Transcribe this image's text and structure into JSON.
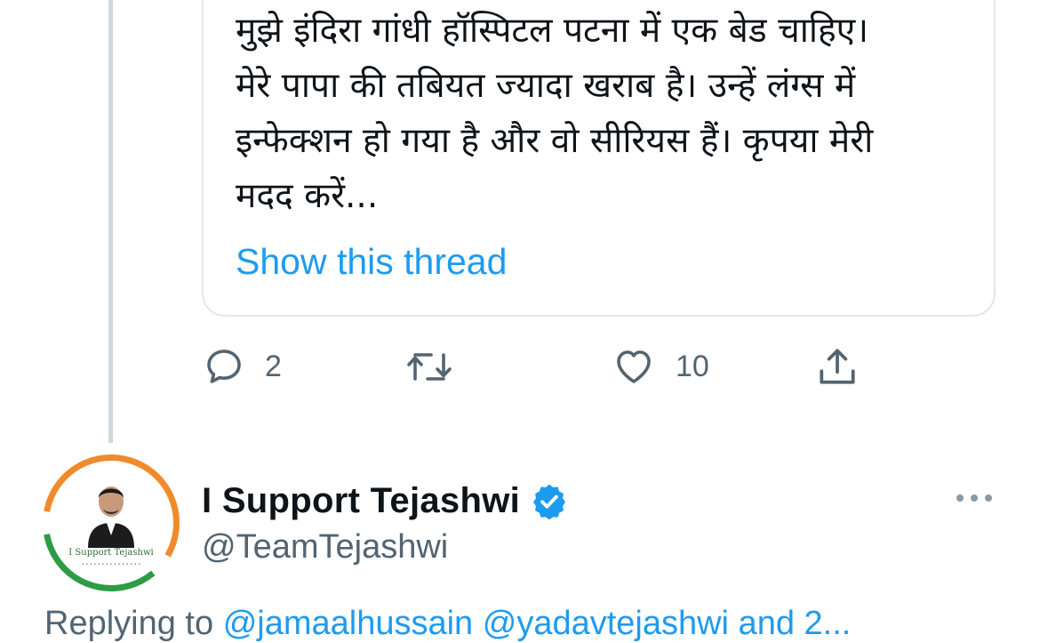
{
  "quoted_tweet": {
    "text": "मुझे इंदिरा गांधी हॉस्पिटल पटना में एक बेड चाहिए।\nमेरे पापा की तबियत ज्यादा खराब है। उन्हें लंग्स में\nइन्फेक्शन हो गया है और वो सीरियस हैं। कृपया मेरी\nमदद करें...",
    "show_thread_label": "Show this thread"
  },
  "actions": {
    "reply_icon": "reply-bubble-icon",
    "reply_count": "2",
    "retweet_icon": "retweet-icon",
    "retweet_count": "",
    "like_icon": "heart-icon",
    "like_count": "10",
    "share_icon": "share-upload-icon"
  },
  "reply_tweet": {
    "avatar_caption": "I Support Tejashwi",
    "display_name": "I Support Tejashwi",
    "verified": true,
    "handle": "@TeamTejashwi",
    "replying_to_label": "Replying to",
    "replying_to_mentions": "@jamaalhussain @yadavtejashwi and 2..."
  },
  "colors": {
    "accent": "#1d9bf0",
    "secondary_text": "#536471",
    "border": "#e1e8ed",
    "thread_line": "#cfd9de"
  }
}
